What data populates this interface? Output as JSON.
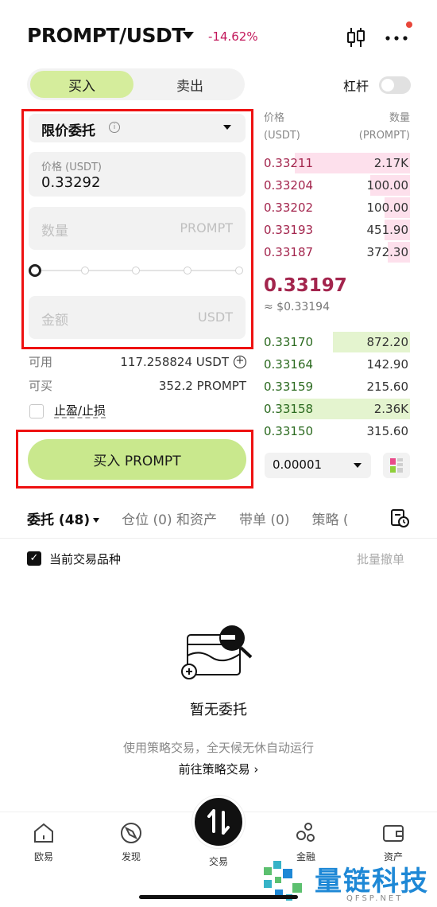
{
  "header": {
    "pair": "PROMPT/USDT",
    "change": "-14.62%",
    "change_color": "#c2185b"
  },
  "side_toggle": {
    "buy": "买入",
    "sell": "卖出",
    "active": "buy"
  },
  "leverage": {
    "label": "杠杆",
    "enabled": false
  },
  "order_form": {
    "order_type": "限价委托",
    "price_label": "价格 (USDT)",
    "price_value": "0.33292",
    "qty_placeholder": "数量",
    "qty_unit": "PROMPT",
    "slider_percent": 0,
    "amount_placeholder": "金额",
    "amount_unit": "USDT",
    "available_label": "可用",
    "available_value": "117.258824 USDT",
    "buyable_label": "可买",
    "buyable_value": "352.2 PROMPT",
    "tpsl_label": "止盈/止损",
    "submit_label": "买入 PROMPT"
  },
  "order_book": {
    "price_header": [
      "价格",
      "(USDT)"
    ],
    "qty_header": [
      "数量",
      "(PROMPT)"
    ],
    "asks": [
      {
        "price": "0.33211",
        "qty": "2.17K",
        "depth": 0.78
      },
      {
        "price": "0.33204",
        "qty": "100.00",
        "depth": 0.27
      },
      {
        "price": "0.33202",
        "qty": "100.00",
        "depth": 0.17
      },
      {
        "price": "0.33193",
        "qty": "451.90",
        "depth": 0.17
      },
      {
        "price": "0.33187",
        "qty": "372.30",
        "depth": 0.15
      }
    ],
    "mid_price": "0.33197",
    "mid_usd": "≈ $0.33194",
    "bids": [
      {
        "price": "0.33170",
        "qty": "872.20",
        "depth": 0.52
      },
      {
        "price": "0.33164",
        "qty": "142.90",
        "depth": 0.0
      },
      {
        "price": "0.33159",
        "qty": "215.60",
        "depth": 0.0
      },
      {
        "price": "0.33158",
        "qty": "2.36K",
        "depth": 0.88
      },
      {
        "price": "0.33150",
        "qty": "315.60",
        "depth": 0.0
      }
    ],
    "tick_size": "0.00001"
  },
  "tabs": {
    "orders": "委托 (48)",
    "positions": "仓位 (0) 和资产",
    "bracket": "带单 (0)",
    "strategy": "策略 ("
  },
  "filter": {
    "current_only": "当前交易品种",
    "batch_cancel": "批量撤单"
  },
  "empty": {
    "title": "暂无委托",
    "desc": "使用策略交易，全天候无休自动运行",
    "link": "前往策略交易 ›"
  },
  "nav": {
    "home": "欧易",
    "discover": "发现",
    "trade": "交易",
    "finance": "金融",
    "assets": "资产"
  },
  "watermark": {
    "name": "量链科技",
    "domain": "QFSP.NET"
  }
}
